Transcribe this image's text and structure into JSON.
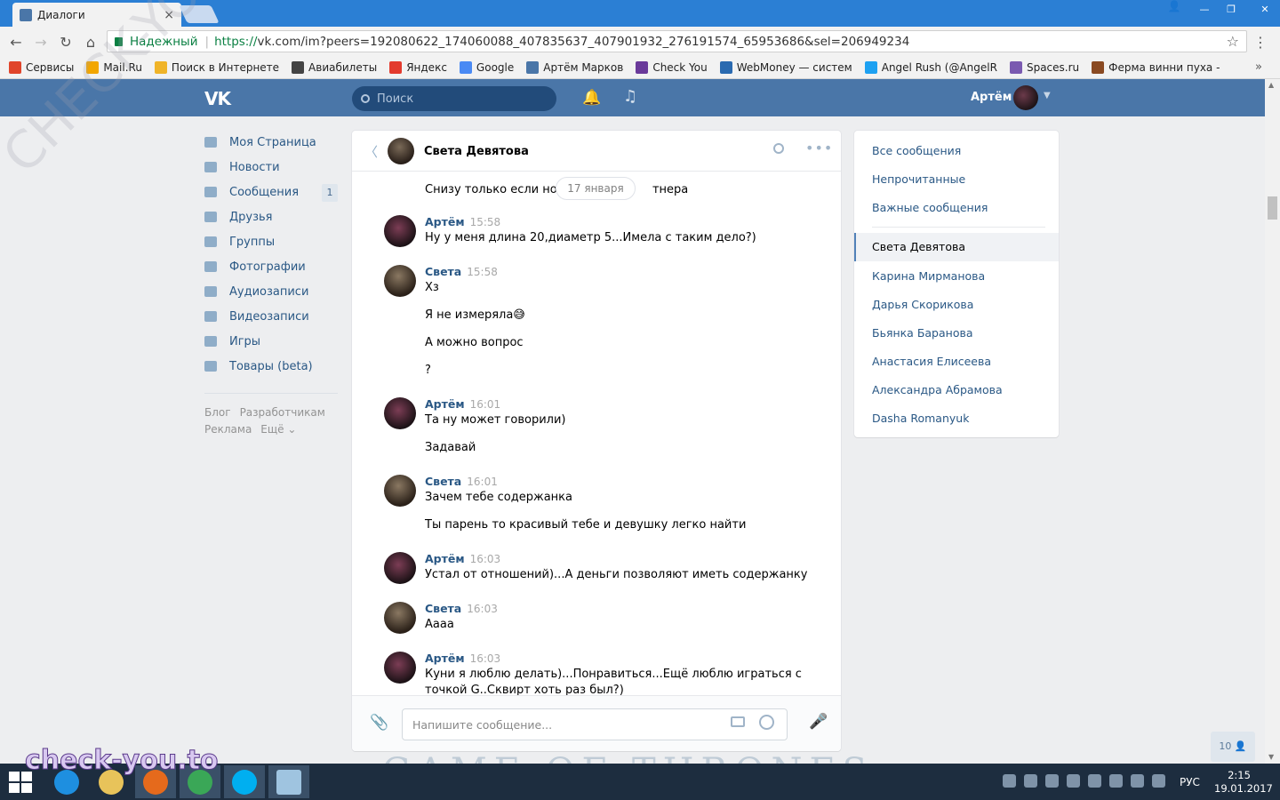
{
  "browser": {
    "tab_title": "Диалоги",
    "tab_close": "×",
    "secure_label": "Надежный",
    "url_scheme": "https://",
    "url_rest": "vk.com/im?peers=192080622_174060088_407835637_407901932_276191574_65953686&sel=206949234",
    "back_icon": "arrow-left-icon",
    "bookmarks": [
      {
        "label": "Сервисы",
        "color": "#e0452b"
      },
      {
        "label": "Mail.Ru",
        "color": "#f2a600"
      },
      {
        "label": "Поиск в Интернете",
        "color": "#f0b428"
      },
      {
        "label": "Авиабилеты",
        "color": "#444444"
      },
      {
        "label": "Яндекс",
        "color": "#e33b2e"
      },
      {
        "label": "Google",
        "color": "#4a8af4"
      },
      {
        "label": "Артём Марков",
        "color": "#4a76a8"
      },
      {
        "label": "Check You",
        "color": "#6a3a9a"
      },
      {
        "label": "WebMoney — систем",
        "color": "#2a6ab0"
      },
      {
        "label": "Angel Rush (@AngelR",
        "color": "#1da1f2"
      },
      {
        "label": "Spaces.ru",
        "color": "#7a5ab0"
      },
      {
        "label": "Ферма винни пуха -",
        "color": "#8a4a22"
      }
    ],
    "bookmarks_more": "»"
  },
  "vk": {
    "logo": "VK",
    "search_placeholder": "Поиск",
    "user_name": "Артём",
    "nav": [
      {
        "label": "Моя Страница",
        "icon": "home-icon"
      },
      {
        "label": "Новости",
        "icon": "news-icon"
      },
      {
        "label": "Сообщения",
        "icon": "messages-icon",
        "count": "1"
      },
      {
        "label": "Друзья",
        "icon": "friends-icon"
      },
      {
        "label": "Группы",
        "icon": "groups-icon"
      },
      {
        "label": "Фотографии",
        "icon": "photos-icon"
      },
      {
        "label": "Аудиозаписи",
        "icon": "audio-icon"
      },
      {
        "label": "Видеозаписи",
        "icon": "video-icon"
      },
      {
        "label": "Игры",
        "icon": "games-icon"
      },
      {
        "label": "Товары (beta)",
        "icon": "market-icon"
      }
    ],
    "footer": {
      "blog": "Блог",
      "dev": "Разработчикам",
      "ads": "Реклама",
      "more": "Ещё ⌄"
    }
  },
  "chat": {
    "peer_name": "Света Девятова",
    "partial_before": "Снизу только если ноги",
    "partial_after": "тнера",
    "date_pill": "17 января",
    "messages": [
      {
        "author": "Артём",
        "time": "15:58",
        "lines": [
          "Ну у меня длина 20,диаметр 5...Имела с таким дело?)"
        ]
      },
      {
        "author": "Света",
        "time": "15:58",
        "lines": [
          "Хз",
          "Я не измеряла😅",
          "А можно вопрос",
          "?"
        ]
      },
      {
        "author": "Артём",
        "time": "16:01",
        "lines": [
          "Та ну может говорили)",
          "Задавай"
        ]
      },
      {
        "author": "Света",
        "time": "16:01",
        "lines": [
          "Зачем тебе содержанка",
          "Ты парень то красивый тебе и девушку легко найти"
        ]
      },
      {
        "author": "Артём",
        "time": "16:03",
        "lines": [
          "Устал от отношений)...А деньги позволяют иметь содержанку"
        ]
      },
      {
        "author": "Света",
        "time": "16:03",
        "lines": [
          "Аааа"
        ]
      },
      {
        "author": "Артём",
        "time": "16:03",
        "lines": [
          "Куни я люблю делать)...Понравиться...Ещё люблю играться с",
          "точкой G..Сквирт хоть раз был?)"
        ]
      }
    ],
    "input_placeholder": "Напишите сообщение..."
  },
  "right_panel": {
    "filters": [
      "Все сообщения",
      "Непрочитанные",
      "Важные сообщения"
    ],
    "active": "Света Девятова",
    "dialogs": [
      "Карина Мирманова",
      "Дарья Скорикова",
      "Бьянка Баранова",
      "Анастасия Елисеева",
      "Александра Абрамова",
      "Dasha Romanyuk"
    ]
  },
  "online_count": "10 👤",
  "banner": "GAME OF THRONES",
  "taskbar": {
    "lang": "РУС",
    "time": "2:15",
    "date": "19.01.2017",
    "apps": [
      {
        "name": "internet-explorer-icon",
        "color": "#1e8fe0"
      },
      {
        "name": "file-explorer-icon",
        "color": "#e8c35a"
      },
      {
        "name": "firefox-icon",
        "color": "#e56a1c"
      },
      {
        "name": "chrome-icon",
        "color": "#3aa757"
      },
      {
        "name": "skype-icon",
        "color": "#00aff0"
      },
      {
        "name": "notepad-icon",
        "color": "#9fc4e0"
      }
    ]
  },
  "watermark": "check-you.to",
  "watermark_diag": "CHECK-YOU.ME"
}
